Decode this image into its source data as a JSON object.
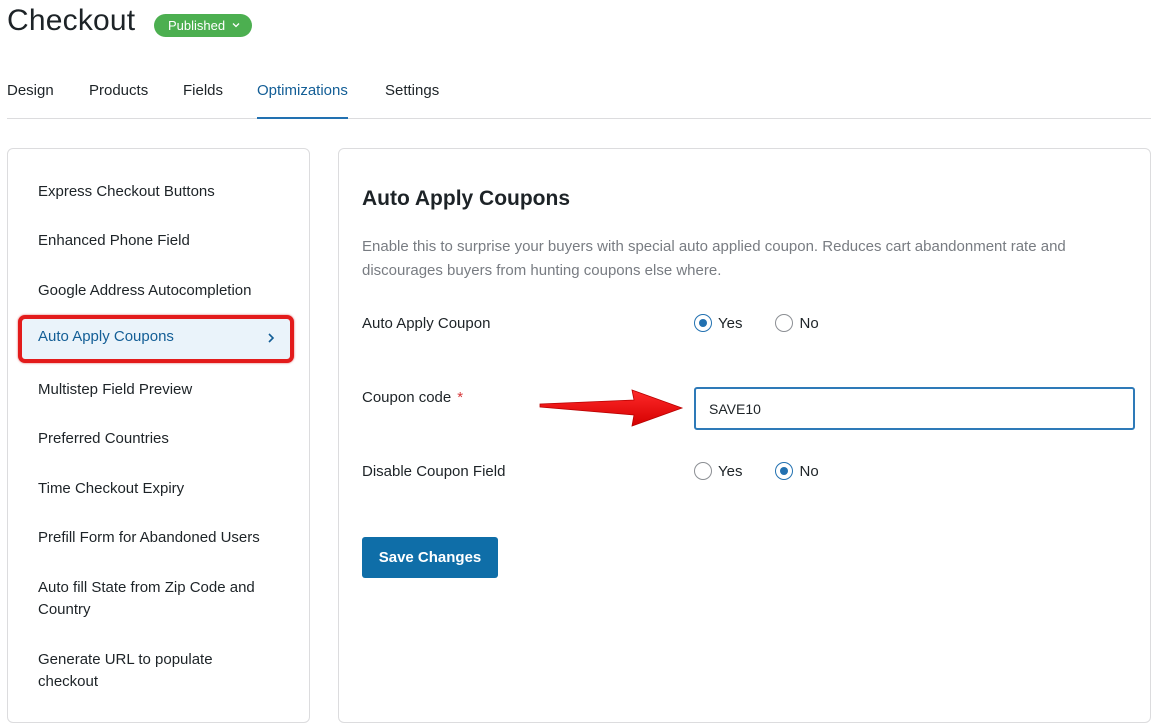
{
  "header": {
    "title": "Checkout",
    "status": "Published"
  },
  "tabs": [
    {
      "label": "Design",
      "active": false
    },
    {
      "label": "Products",
      "active": false
    },
    {
      "label": "Fields",
      "active": false
    },
    {
      "label": "Optimizations",
      "active": true
    },
    {
      "label": "Settings",
      "active": false
    }
  ],
  "sidebar": {
    "items": [
      {
        "label": "Express Checkout Buttons"
      },
      {
        "label": "Enhanced Phone Field"
      },
      {
        "label": "Google Address Autocompletion"
      },
      {
        "label": "Auto Apply Coupons",
        "active": true
      },
      {
        "label": "Multistep Field Preview"
      },
      {
        "label": "Preferred Countries"
      },
      {
        "label": "Time Checkout Expiry"
      },
      {
        "label": "Prefill Form for Abandoned Users"
      },
      {
        "label": "Auto fill State from Zip Code and Country"
      },
      {
        "label": "Generate URL to populate checkout"
      }
    ]
  },
  "main": {
    "title": "Auto Apply Coupons",
    "description": "Enable this to surprise your buyers with special auto applied coupon. Reduces cart abandonment rate and discourages buyers from hunting coupons else where.",
    "auto_apply": {
      "label": "Auto Apply Coupon",
      "options": [
        "Yes",
        "No"
      ],
      "selected": "Yes"
    },
    "coupon_code": {
      "label": "Coupon code",
      "required_mark": "*",
      "value": "SAVE10"
    },
    "disable_field": {
      "label": "Disable Coupon Field",
      "options": [
        "Yes",
        "No"
      ],
      "selected": "No"
    },
    "save_label": "Save Changes"
  },
  "colors": {
    "accent": "#2271b1",
    "badge": "#4caf50",
    "highlight_border": "#e31b1b",
    "button": "#0f6ea8"
  },
  "icons": {
    "status_dropdown": "chevron-down-icon",
    "active_item": "chevron-right-icon",
    "annotation": "red-arrow-icon"
  }
}
